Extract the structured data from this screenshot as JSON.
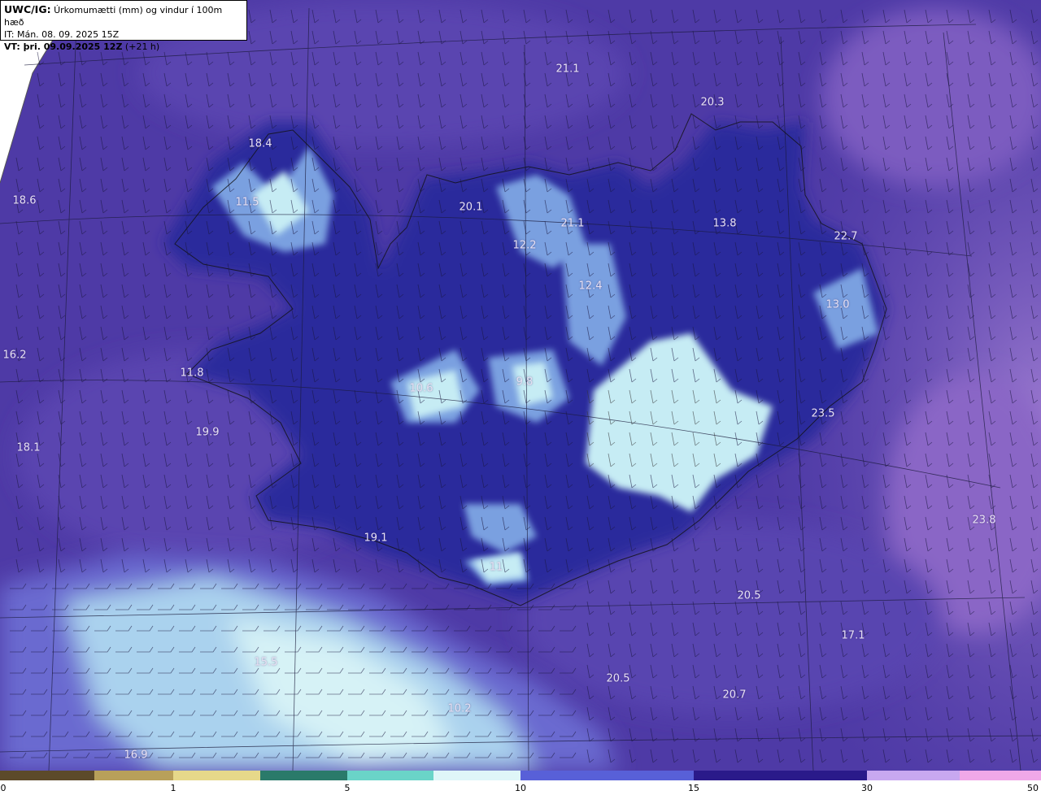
{
  "header": {
    "product_label": "UWC/IG:",
    "product_text": " Úrkomumætti (mm) og vindur í 100m hæð",
    "it_label": "IT:",
    "it_text": " Mán. 08. 09. 2025 15Z",
    "vt_label": "VT: þri. 09.09.2025 12Z",
    "vt_text": " (+21 h)"
  },
  "map_values": [
    "21.1",
    "20.3",
    "18.4",
    "18.6",
    "11.5",
    "20.1",
    "21.1",
    "13.8",
    "22.7",
    "12.2",
    "12.4",
    "13.0",
    "16.2",
    "11.8",
    "10.6",
    "9.8",
    "23.5",
    "19.9",
    "18.1",
    "23.8",
    "19.1",
    "11",
    "20.5",
    "17.1",
    "15.5",
    "20.5",
    "20.7",
    "16.9",
    "10.2"
  ],
  "colorbar": {
    "ticks": [
      "0",
      "1",
      "5",
      "10",
      "15",
      "30",
      "50"
    ],
    "colors": [
      "#5c4a2a",
      "#b8a05a",
      "#e6d88a",
      "#2a7a6a",
      "#6ad4c8",
      "#dff6f8",
      "#5860d8",
      "#2a1a8a",
      "#c8a8f0",
      "#f0a8e8",
      "#8a1a7a"
    ]
  },
  "colors": {
    "sea_base": "#5a44ae",
    "land_base": "#2a2a9a",
    "high_precip": "#bfe8f2",
    "east_sea": "#7a5cc0"
  }
}
